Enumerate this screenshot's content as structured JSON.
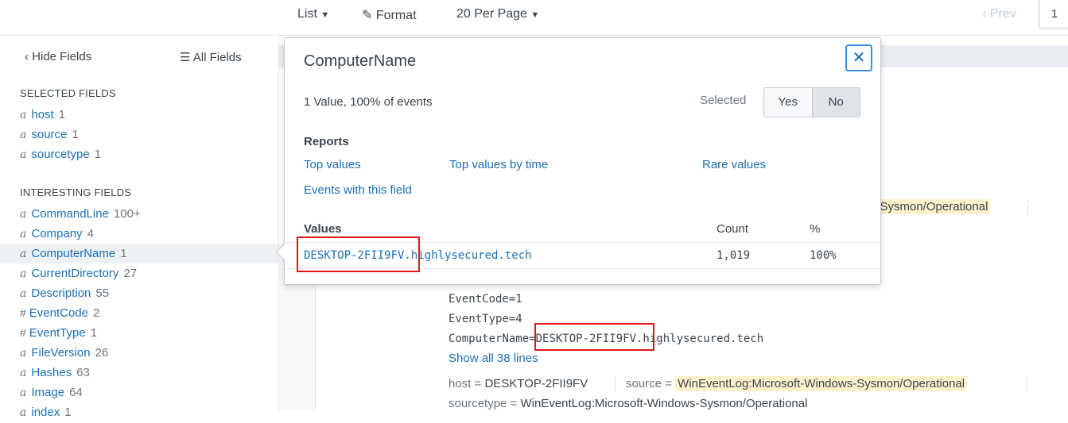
{
  "toolbar": {
    "list_label": "List",
    "format_label": "Format",
    "per_page_label": "20 Per Page",
    "prev_label": "‹ Prev",
    "current_page": "1"
  },
  "sidebar": {
    "hide_fields": "‹ Hide Fields",
    "all_fields": "All Fields",
    "selected_title": "SELECTED FIELDS",
    "selected": [
      {
        "type": "a",
        "name": "host",
        "count": "1"
      },
      {
        "type": "a",
        "name": "source",
        "count": "1"
      },
      {
        "type": "a",
        "name": "sourcetype",
        "count": "1"
      }
    ],
    "interesting_title": "INTERESTING FIELDS",
    "interesting": [
      {
        "type": "a",
        "name": "CommandLine",
        "count": "100+"
      },
      {
        "type": "a",
        "name": "Company",
        "count": "4"
      },
      {
        "type": "a",
        "name": "ComputerName",
        "count": "1"
      },
      {
        "type": "a",
        "name": "CurrentDirectory",
        "count": "27"
      },
      {
        "type": "a",
        "name": "Description",
        "count": "55"
      },
      {
        "type": "#",
        "name": "EventCode",
        "count": "2"
      },
      {
        "type": "#",
        "name": "EventType",
        "count": "1"
      },
      {
        "type": "a",
        "name": "FileVersion",
        "count": "26"
      },
      {
        "type": "a",
        "name": "Hashes",
        "count": "63"
      },
      {
        "type": "a",
        "name": "Image",
        "count": "64"
      },
      {
        "type": "a",
        "name": "index",
        "count": "1"
      }
    ]
  },
  "popup": {
    "title": "ComputerName",
    "summary": "1 Value, 100% of events",
    "selected_label": "Selected",
    "yes_label": "Yes",
    "no_label": "No",
    "reports_title": "Reports",
    "report_links": {
      "top_values": "Top values",
      "top_values_by_time": "Top values by time",
      "rare_values": "Rare values",
      "events_with_field": "Events with this field"
    },
    "values_header": "Values",
    "count_header": "Count",
    "pct_header": "%",
    "rows": [
      {
        "value": "DESKTOP-2FII9FV.highlysecured.tech",
        "count": "1,019",
        "pct": "100%"
      }
    ]
  },
  "event": {
    "source_fragment": "s-Sysmon/Operational",
    "lines": [
      "EventCode=1",
      "EventType=4",
      "ComputerName=DESKTOP-2FII9FV.highlysecured.tech"
    ],
    "show_all": "Show all 38 lines",
    "host_key": "host =",
    "host_val": "DESKTOP-2FII9FV",
    "source_key": "source =",
    "source_val": "WinEventLog:Microsoft-Windows-Sysmon/Operational",
    "sourcetype_key": "sourcetype =",
    "sourcetype_val": "WinEventLog:Microsoft-Windows-Sysmon/Operational"
  },
  "colors": {
    "link": "#1a6fb5",
    "highlight": "#fdf1cc",
    "annotation_red": "#e0161b",
    "close_border": "#3a8fd6"
  }
}
